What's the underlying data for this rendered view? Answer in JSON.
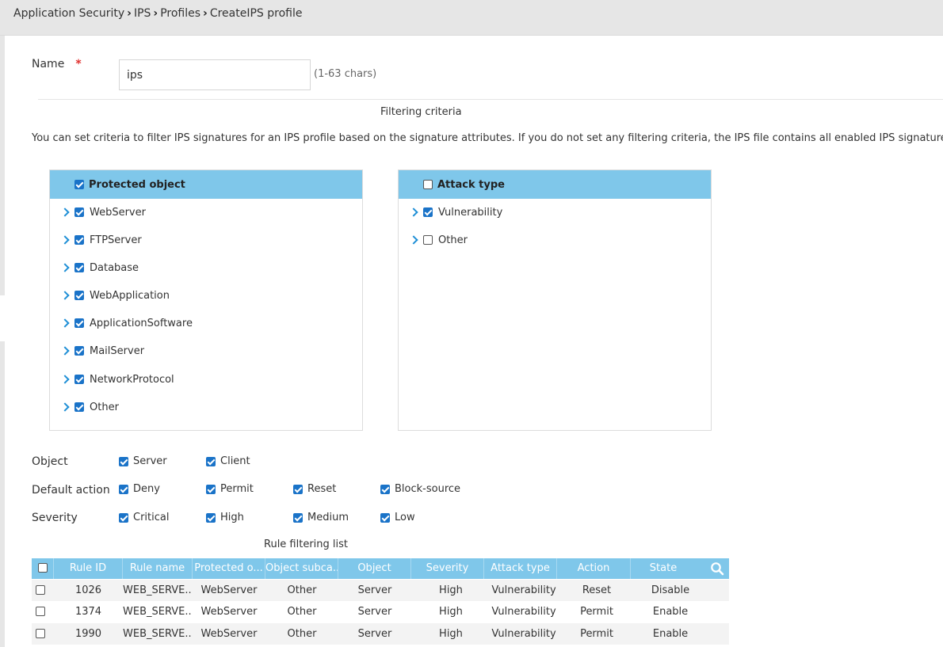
{
  "breadcrumb": {
    "items": [
      "Application Security",
      "IPS",
      "Profiles",
      "CreateIPS profile"
    ]
  },
  "form": {
    "name_label": "Name",
    "required_mark": "*",
    "name_value": "ips",
    "name_hint": "(1-63 chars)"
  },
  "filtering": {
    "title": "Filtering criteria",
    "description": "You can set criteria to filter IPS signatures for an IPS profile based on the signature attributes. If you do not set any filtering criteria, the IPS file contains all enabled IPS signatures."
  },
  "protected_object": {
    "header": "Protected object",
    "header_checked": true,
    "items": [
      {
        "label": "WebServer",
        "checked": true
      },
      {
        "label": "FTPServer",
        "checked": true
      },
      {
        "label": "Database",
        "checked": true
      },
      {
        "label": "WebApplication",
        "checked": true
      },
      {
        "label": "ApplicationSoftware",
        "checked": true
      },
      {
        "label": "MailServer",
        "checked": true
      },
      {
        "label": "NetworkProtocol",
        "checked": true
      },
      {
        "label": "Other",
        "checked": true
      }
    ]
  },
  "attack_type": {
    "header": "Attack type",
    "header_checked": false,
    "items": [
      {
        "label": "Vulnerability",
        "checked": true
      },
      {
        "label": "Other",
        "checked": false
      }
    ]
  },
  "options": {
    "object": {
      "label": "Object",
      "items": [
        {
          "label": "Server",
          "checked": true
        },
        {
          "label": "Client",
          "checked": true
        }
      ]
    },
    "default_action": {
      "label": "Default action",
      "items": [
        {
          "label": "Deny",
          "checked": true
        },
        {
          "label": "Permit",
          "checked": true
        },
        {
          "label": "Reset",
          "checked": true
        },
        {
          "label": "Block-source",
          "checked": true
        }
      ]
    },
    "severity": {
      "label": "Severity",
      "items": [
        {
          "label": "Critical",
          "checked": true
        },
        {
          "label": "High",
          "checked": true
        },
        {
          "label": "Medium",
          "checked": true
        },
        {
          "label": "Low",
          "checked": true
        }
      ]
    }
  },
  "rule_list": {
    "title": "Rule filtering list",
    "columns": [
      "Rule ID",
      "Rule name",
      "Protected o...",
      "Object subca...",
      "Object",
      "Severity",
      "Attack type",
      "Action",
      "State"
    ],
    "rows": [
      [
        "1026",
        "WEB_SERVE...",
        "WebServer",
        "Other",
        "Server",
        "High",
        "Vulnerability",
        "Reset",
        "Disable"
      ],
      [
        "1374",
        "WEB_SERVE...",
        "WebServer",
        "Other",
        "Server",
        "High",
        "Vulnerability",
        "Permit",
        "Enable"
      ],
      [
        "1990",
        "WEB_SERVE...",
        "WebServer",
        "Other",
        "Server",
        "High",
        "Vulnerability",
        "Permit",
        "Enable"
      ]
    ]
  },
  "colors": {
    "accent": "#1a73c8",
    "panel_header": "#7fc7ea",
    "required": "#e0302e",
    "topbar": "#e6e6e6"
  }
}
